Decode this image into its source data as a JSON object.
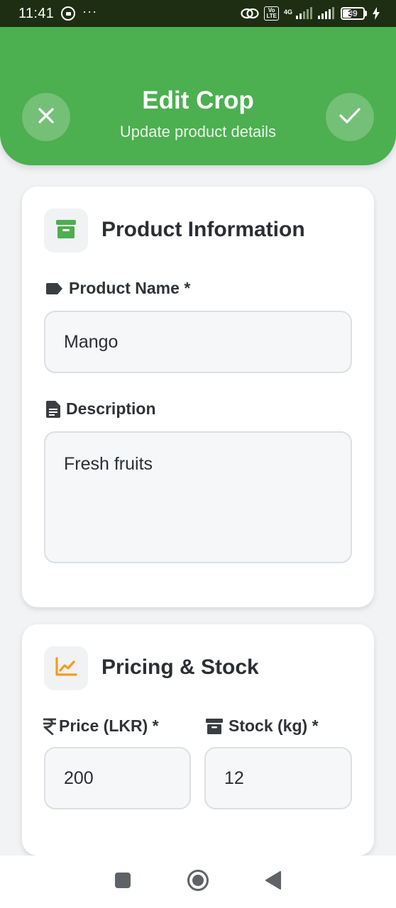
{
  "status_bar": {
    "time": "11:41",
    "dots": "···",
    "volte": "Vo\nLTE",
    "network": "4G",
    "battery": "39"
  },
  "header": {
    "title": "Edit Crop",
    "subtitle": "Update product details",
    "close_icon": "close-icon",
    "save_icon": "check-icon",
    "background_color": "#4caf50"
  },
  "product_section": {
    "title": "Product Information",
    "icon": "archive-box-icon",
    "icon_color": "#4caf50",
    "product_name": {
      "label": "Product Name *",
      "icon": "tag-icon",
      "value": "Mango"
    },
    "description": {
      "label": "Description",
      "icon": "document-icon",
      "value": "Fresh fruits"
    }
  },
  "pricing_section": {
    "title": "Pricing & Stock",
    "icon": "trending-up-chart-icon",
    "icon_color": "#f59c1a",
    "price": {
      "label": "Price (LKR) *",
      "icon": "rupee-icon",
      "value": "200"
    },
    "stock": {
      "label": "Stock (kg) *",
      "icon": "archive-box-icon",
      "value": "12"
    }
  },
  "nav_bar": {
    "recents_icon": "square-icon",
    "home_icon": "circle-home-icon",
    "back_icon": "triangle-back-icon"
  }
}
